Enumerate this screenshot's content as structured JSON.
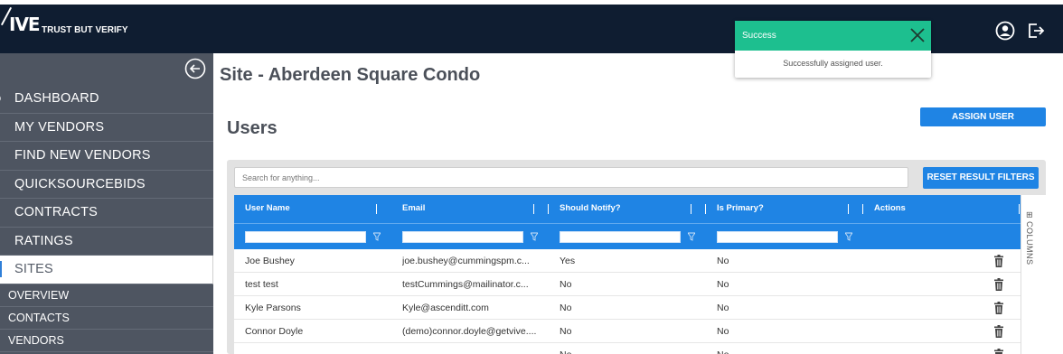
{
  "header": {
    "logo_text": "IVE",
    "tagline": "TRUST BUT VERIFY"
  },
  "toast": {
    "title": "Success",
    "message": "Successfully assigned user.",
    "color": "#1dbf8f"
  },
  "sidebar": {
    "items": [
      {
        "label": "DASHBOARD"
      },
      {
        "label": "MY VENDORS"
      },
      {
        "label": "FIND NEW VENDORS"
      },
      {
        "label": "QUICKSOURCEBIDS"
      },
      {
        "label": "CONTRACTS"
      },
      {
        "label": "RATINGS"
      },
      {
        "label": "SITES"
      }
    ],
    "sub_items": [
      {
        "label": "OVERVIEW"
      },
      {
        "label": "CONTACTS"
      },
      {
        "label": "VENDORS"
      }
    ]
  },
  "main": {
    "site_title": "Site - Aberdeen Square Condo",
    "section_title": "Users",
    "assign_button": "ASSIGN USER",
    "search_placeholder": "Search for anything...",
    "reset_button": "RESET RESULT FILTERS",
    "columns_label": "COLUMNS",
    "headers": [
      "User Name",
      "Email",
      "Should Notify?",
      "Is Primary?",
      "Actions"
    ],
    "rows": [
      {
        "name": "Joe Bushey",
        "email": "joe.bushey@cummingspm.c...",
        "notify": "Yes",
        "primary": "No"
      },
      {
        "name": "test test",
        "email": "testCummings@mailinator.c...",
        "notify": "No",
        "primary": "No"
      },
      {
        "name": "Kyle Parsons",
        "email": "Kyle@ascenditt.com",
        "notify": "No",
        "primary": "No"
      },
      {
        "name": "Connor Doyle",
        "email": "(demo)connor.doyle@getvive....",
        "notify": "No",
        "primary": "No"
      },
      {
        "name": "",
        "email": "",
        "notify": "No",
        "primary": "No"
      }
    ]
  },
  "colors": {
    "topbar": "#0f1d31",
    "sidebar": "#4e5561",
    "accent": "#1f84e4"
  }
}
